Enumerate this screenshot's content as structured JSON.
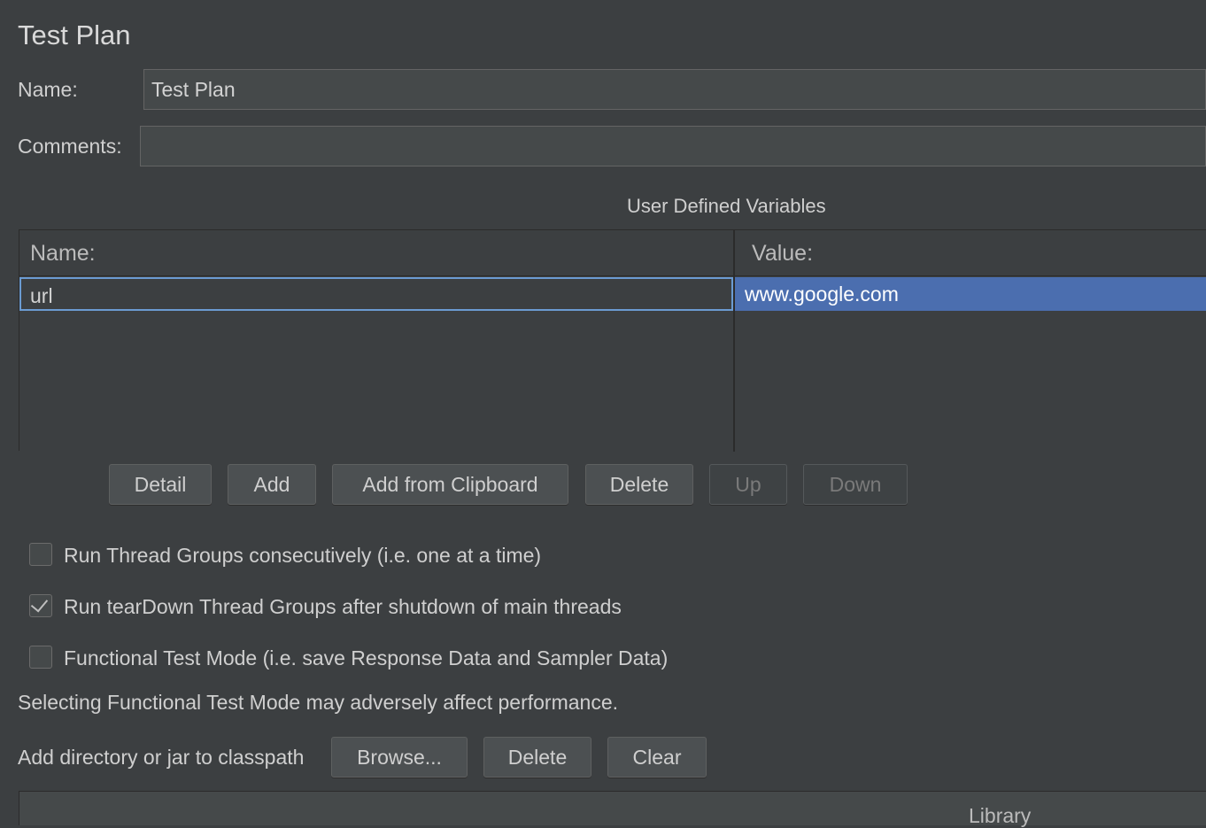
{
  "panel": {
    "title": "Test Plan",
    "name_label": "Name:",
    "name_value": "Test Plan",
    "comments_label": "Comments:",
    "comments_value": ""
  },
  "variables": {
    "section_title": "User Defined Variables",
    "columns": [
      "Name:",
      "Value:"
    ],
    "rows": [
      {
        "name": "url",
        "value": "www.google.com"
      }
    ],
    "buttons": {
      "detail": "Detail",
      "add": "Add",
      "add_clipboard": "Add from Clipboard",
      "delete": "Delete",
      "up": "Up",
      "down": "Down"
    }
  },
  "options": {
    "run_consecutively": {
      "label": "Run Thread Groups consecutively (i.e. one at a time)",
      "checked": false
    },
    "run_teardown": {
      "label": "Run tearDown Thread Groups after shutdown of main threads",
      "checked": true
    },
    "functional_mode": {
      "label": "Functional Test Mode (i.e. save Response Data and Sampler Data)",
      "checked": false
    },
    "functional_note": "Selecting Functional Test Mode may adversely affect performance."
  },
  "classpath": {
    "label": "Add directory or jar to classpath",
    "browse": "Browse...",
    "delete": "Delete",
    "clear": "Clear",
    "column": "Library"
  }
}
